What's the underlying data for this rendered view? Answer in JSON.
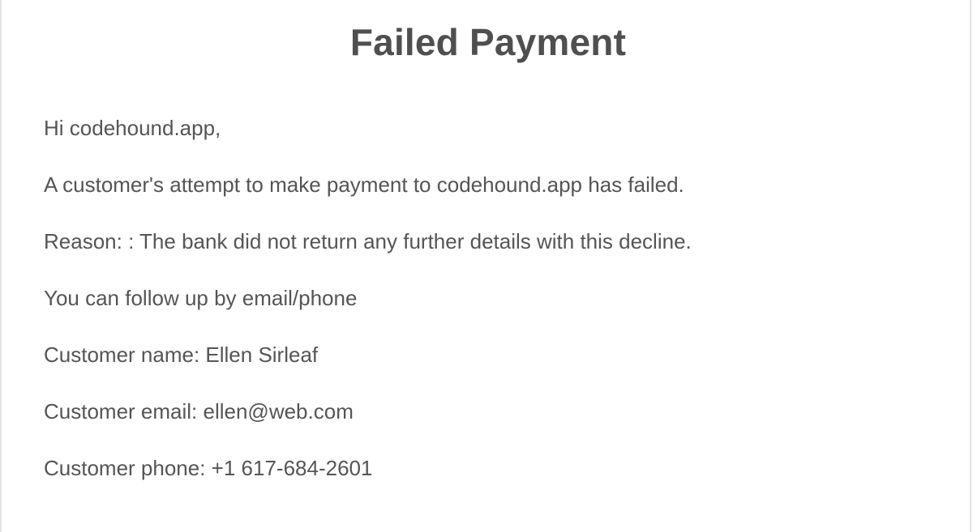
{
  "email": {
    "title": "Failed Payment",
    "greeting": "Hi codehound.app,",
    "message": "A customer's attempt to make payment to codehound.app has failed.",
    "reason": "Reason: : The bank did not return any further details with this decline.",
    "follow_up": "You can follow up by email/phone",
    "customer_name": "Customer name: Ellen Sirleaf",
    "customer_email": "Customer email: ellen@web.com",
    "customer_phone": "Customer phone: +1 617-684-2601"
  }
}
